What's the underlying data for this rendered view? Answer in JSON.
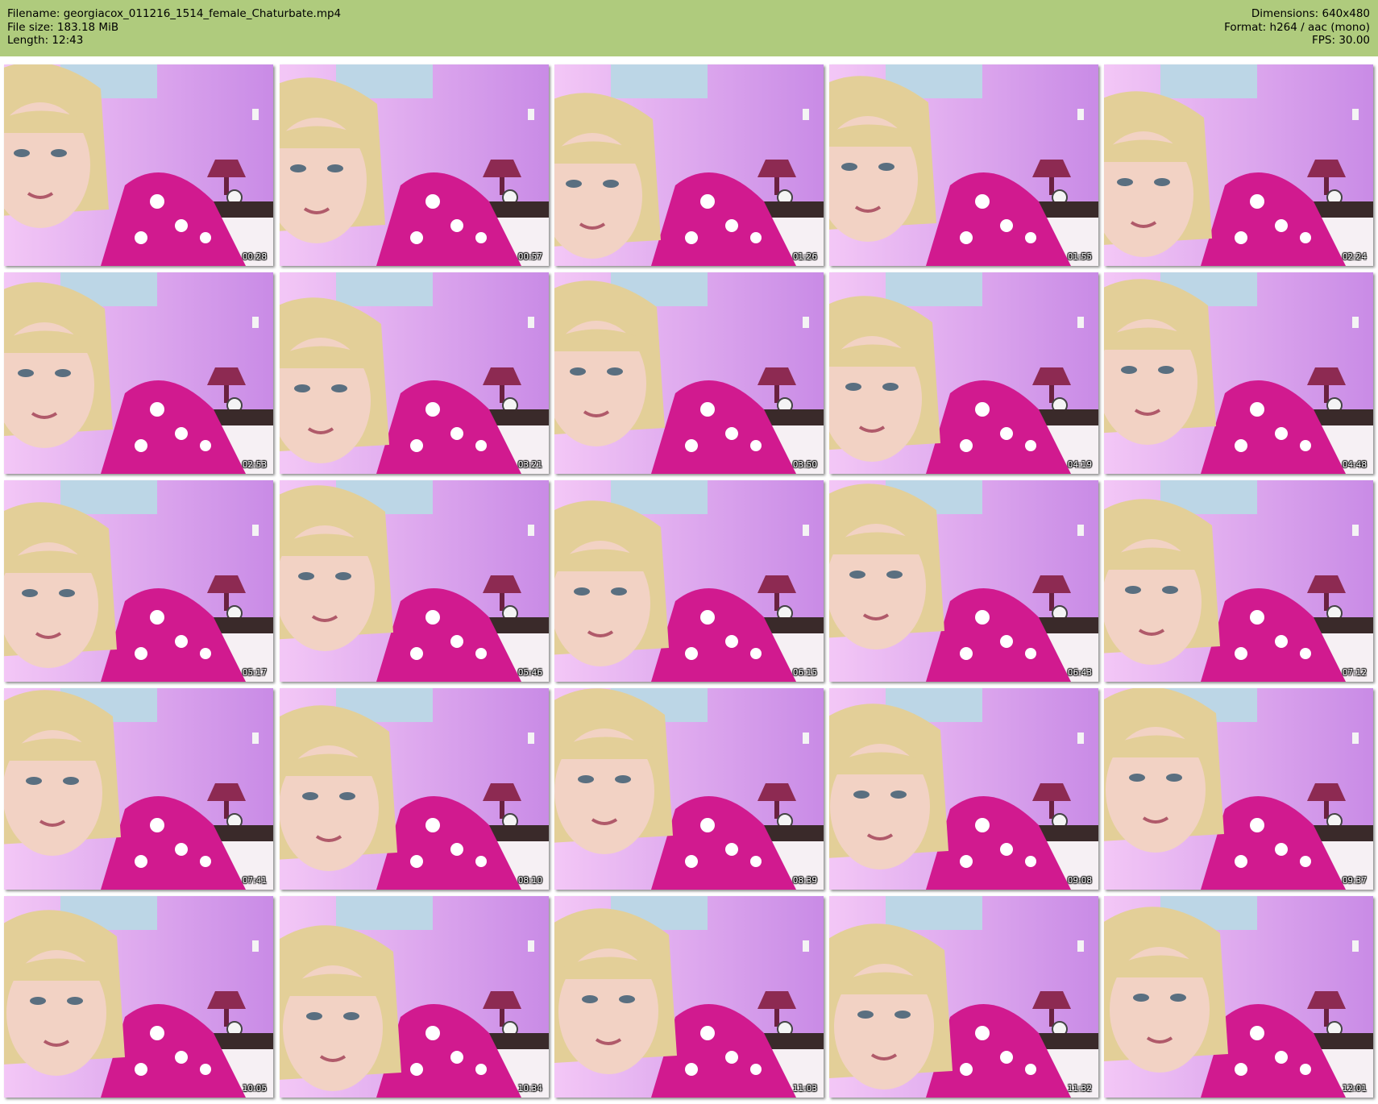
{
  "header": {
    "filename": "Filename: georgiacox_011216_1514_female_Chaturbate.mp4",
    "filesize": "File size: 183.18 MiB",
    "length": "Length: 12:43",
    "dimensions": "Dimensions: 640x480",
    "format": "Format: h264 / aac (mono)",
    "fps": "FPS: 30.00"
  },
  "colors": {
    "header_bg": "#afcb7d",
    "wall": "#c98be6",
    "robe": "#d11a8f",
    "hair": "#e3cf98",
    "skin": "#f2d2c4"
  },
  "thumbnails": [
    {
      "time": "00:28"
    },
    {
      "time": "00:57"
    },
    {
      "time": "01:26"
    },
    {
      "time": "01:55"
    },
    {
      "time": "02:24"
    },
    {
      "time": "02:53"
    },
    {
      "time": "03:21"
    },
    {
      "time": "03:50"
    },
    {
      "time": "04:19"
    },
    {
      "time": "04:48"
    },
    {
      "time": "05:17"
    },
    {
      "time": "05:46"
    },
    {
      "time": "06:15"
    },
    {
      "time": "06:43"
    },
    {
      "time": "07:12"
    },
    {
      "time": "07:41"
    },
    {
      "time": "08:10"
    },
    {
      "time": "08:39"
    },
    {
      "time": "09:08"
    },
    {
      "time": "09:37"
    },
    {
      "time": "10:05"
    },
    {
      "time": "10:34"
    },
    {
      "time": "11:03"
    },
    {
      "time": "11:32"
    },
    {
      "time": "12:01"
    }
  ]
}
